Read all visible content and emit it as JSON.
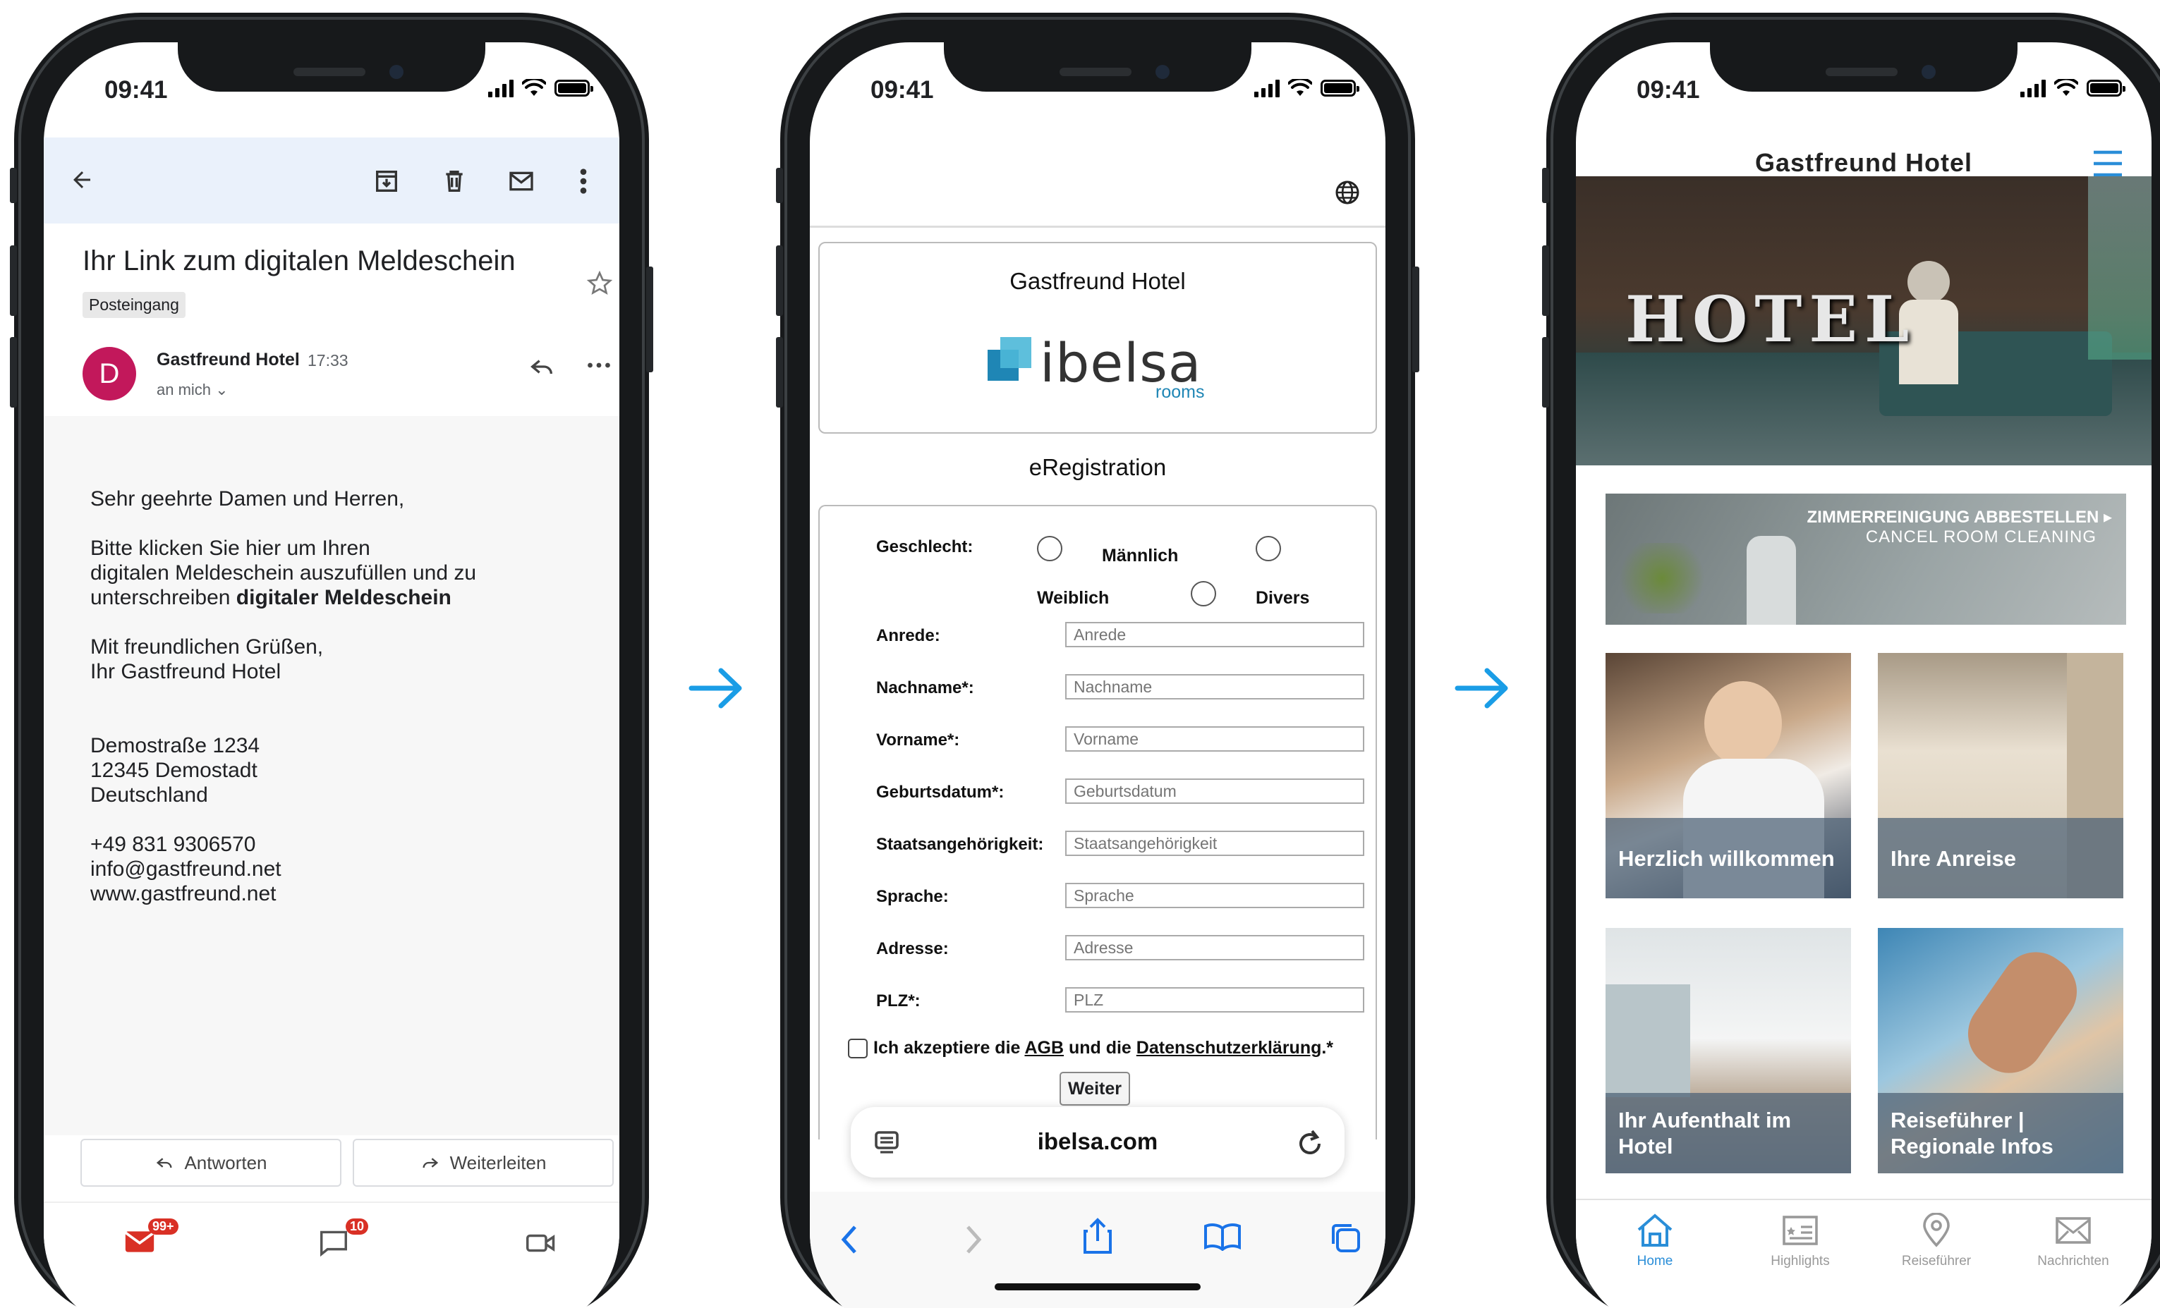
{
  "colors": {
    "arrow": "#1a9de6",
    "mail_avatar": "#c2185b",
    "mail_badge": "#d93025",
    "mail_app_bar": "#eaf1fb",
    "form_link": "#111111",
    "safari_blue": "#1a73e8",
    "app_accent": "#2a8ed8",
    "tile_caption": "#506478"
  },
  "status": {
    "time_1": "09:41",
    "time_2": "09:41",
    "time_3": "09:41"
  },
  "mail": {
    "toolbar": {
      "icons": [
        "back-arrow-icon",
        "archive-icon",
        "trash-icon",
        "mail-icon",
        "more-vertical-icon"
      ]
    },
    "subject": "Ihr Link zum digitalen Meldeschein",
    "label_chip": "Posteingang",
    "avatar_letter": "D",
    "sender": "Gastfreund Hotel",
    "time": "17:33",
    "to": "an mich",
    "body": {
      "greeting": "Sehr geehrte Damen und Herren,",
      "line1": "Bitte klicken Sie hier um Ihren",
      "line2": "digitalen Meldeschein auszufüllen und zu",
      "line3_prefix": "unterschreiben ",
      "line3_link": "digitaler Meldeschein",
      "closing1": "Mit freundlichen Grüßen,",
      "closing2": "Ihr Gastfreund Hotel",
      "addr1": "Demostraße 1234",
      "addr2": "12345 Demostadt",
      "addr3": "Deutschland",
      "phone": "+49 831 9306570",
      "email": "info@gastfreund.net",
      "web": "www.gastfreund.net"
    },
    "reply_button": "Antworten",
    "forward_button": "Weiterleiten",
    "nav": {
      "mail_badge": "99+",
      "chat_badge": "10"
    }
  },
  "form": {
    "hotel_name": "Gastfreund Hotel",
    "logo_text": "ibelsa",
    "logo_sub": "rooms",
    "page_title": "eRegistration",
    "gender_label": "Geschlecht:",
    "gender_options": [
      "Männlich",
      "Weiblich",
      "Divers"
    ],
    "fields": [
      {
        "label": "Anrede:",
        "placeholder": "Anrede"
      },
      {
        "label": "Nachname*:",
        "placeholder": "Nachname"
      },
      {
        "label": "Vorname*:",
        "placeholder": "Vorname"
      },
      {
        "label": "Geburtsdatum*:",
        "placeholder": "Geburtsdatum"
      },
      {
        "label": "Staatsangehörigkeit:",
        "placeholder": "Staatsangehörigkeit"
      },
      {
        "label": "Sprache:",
        "placeholder": "Sprache"
      },
      {
        "label": "Adresse:",
        "placeholder": "Adresse"
      },
      {
        "label": "PLZ*:",
        "placeholder": "PLZ"
      }
    ],
    "consent": {
      "prefix": "Ich akzeptiere die ",
      "agb": "AGB",
      "middle": " und die ",
      "privacy": "Datenschutzerklärung",
      "suffix": ".*"
    },
    "submit": "Weiter",
    "url": "ibelsa.com"
  },
  "app": {
    "title": "Gastfreund Hotel",
    "hero_sign": "HOTEL",
    "banner_line1": "ZIMMERREINIGUNG ABBESTELLEN",
    "banner_line2": "CANCEL ROOM CLEANING",
    "tiles": [
      {
        "caption": "Herzlich willkommen"
      },
      {
        "caption": "Ihre Anreise"
      },
      {
        "caption": "Ihr Aufenthalt im Hotel"
      },
      {
        "caption": "Reiseführer | Regionale Infos"
      }
    ],
    "nav": [
      "Home",
      "Highlights",
      "Reiseführer",
      "Nachrichten"
    ]
  }
}
